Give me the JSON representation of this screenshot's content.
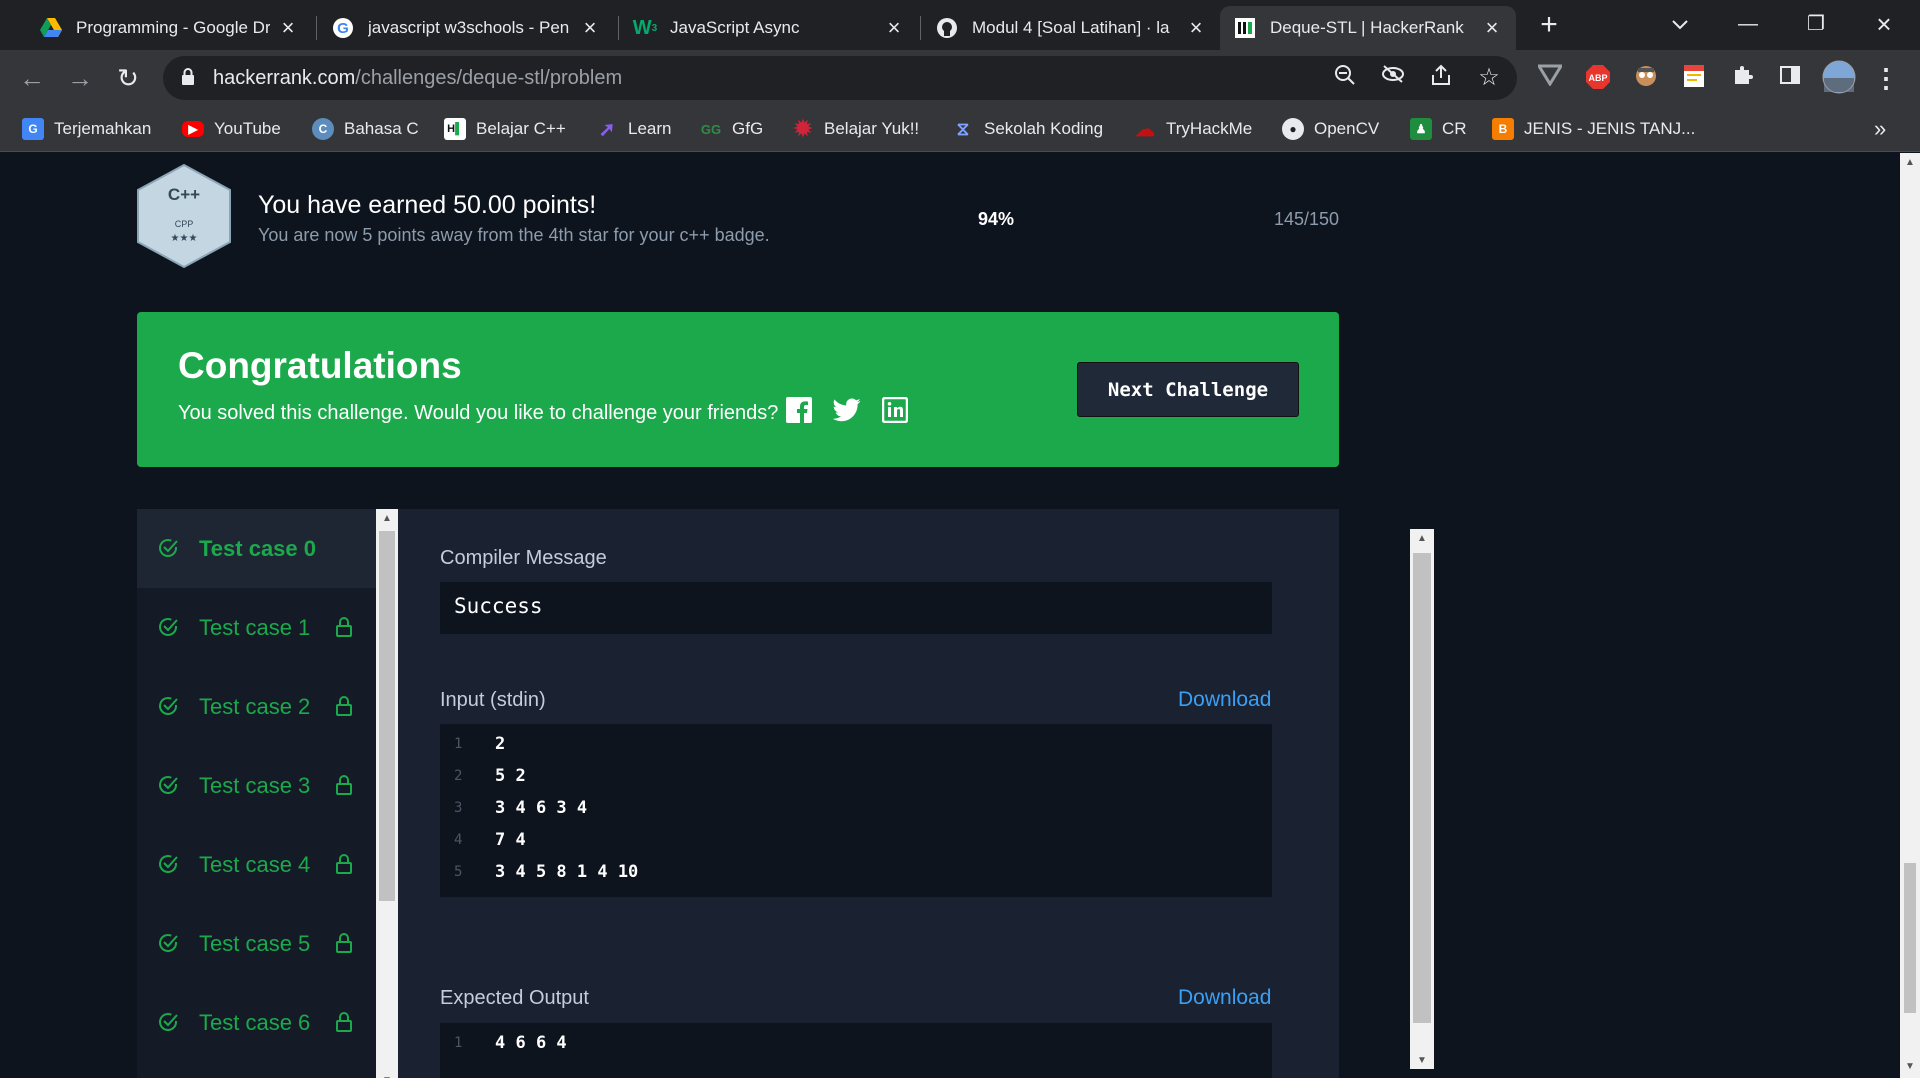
{
  "browser": {
    "tabs": [
      {
        "title": "Programming - Google Dr",
        "icon": "google-drive-icon"
      },
      {
        "title": "javascript w3schools - Pen",
        "icon": "google-icon"
      },
      {
        "title": "JavaScript Async",
        "icon": "w3schools-icon"
      },
      {
        "title": "Modul 4 [Soal Latihan] · la",
        "icon": "github-icon"
      },
      {
        "title": "Deque-STL | HackerRank",
        "icon": "hackerrank-icon",
        "active": true
      }
    ],
    "url_host": "hackerrank.com",
    "url_path": "/challenges/deque-stl/problem",
    "bookmarks": [
      {
        "label": "Terjemahkan",
        "icon": "translate-icon"
      },
      {
        "label": "YouTube",
        "icon": "youtube-icon"
      },
      {
        "label": "Bahasa C",
        "icon": "bahasa-c-icon"
      },
      {
        "label": "Belajar C++",
        "icon": "hackerrank-icon"
      },
      {
        "label": "Learn",
        "icon": "learn-icon"
      },
      {
        "label": "GfG",
        "icon": "gfg-icon"
      },
      {
        "label": "Belajar Yuk!!",
        "icon": "gear-red-icon"
      },
      {
        "label": "Sekolah Koding",
        "icon": "sekolah-koding-icon"
      },
      {
        "label": "TryHackMe",
        "icon": "tryhackme-icon"
      },
      {
        "label": "OpenCV",
        "icon": "github-icon"
      },
      {
        "label": "CR",
        "icon": "classroom-icon"
      },
      {
        "label": "JENIS - JENIS TANJ...",
        "icon": "blogger-icon"
      }
    ],
    "bookmarks_overflow": "»"
  },
  "badge": {
    "lang": "C++",
    "code": "CPP",
    "stars": "★★★"
  },
  "points": {
    "title": "You have earned 50.00 points!",
    "subtitle": "You are now 5 points away from the 4th star for your c++ badge.",
    "percent": "94%",
    "score": "145/150"
  },
  "congrats": {
    "title": "Congratulations",
    "message": "You solved this challenge. Would you like to challenge your friends?",
    "next_button": "Next Challenge",
    "bg_color": "#1ba94c"
  },
  "test_cases": [
    {
      "label": "Test case 0",
      "locked": false,
      "active": true
    },
    {
      "label": "Test case 1",
      "locked": true
    },
    {
      "label": "Test case 2",
      "locked": true
    },
    {
      "label": "Test case 3",
      "locked": true
    },
    {
      "label": "Test case 4",
      "locked": true
    },
    {
      "label": "Test case 5",
      "locked": true
    },
    {
      "label": "Test case 6",
      "locked": true
    }
  ],
  "detail": {
    "compiler_label": "Compiler Message",
    "compiler_message": "Success",
    "input_label": "Input (stdin)",
    "download_label": "Download",
    "input_lines": [
      {
        "n": "1",
        "text": "2"
      },
      {
        "n": "2",
        "text": "5 2"
      },
      {
        "n": "3",
        "text": "3 4 6 3 4"
      },
      {
        "n": "4",
        "text": "7 4"
      },
      {
        "n": "5",
        "text": "3 4 5 8 1 4 10"
      }
    ],
    "expected_label": "Expected Output",
    "expected_lines": [
      {
        "n": "1",
        "text": "4 6 6 4"
      }
    ]
  }
}
